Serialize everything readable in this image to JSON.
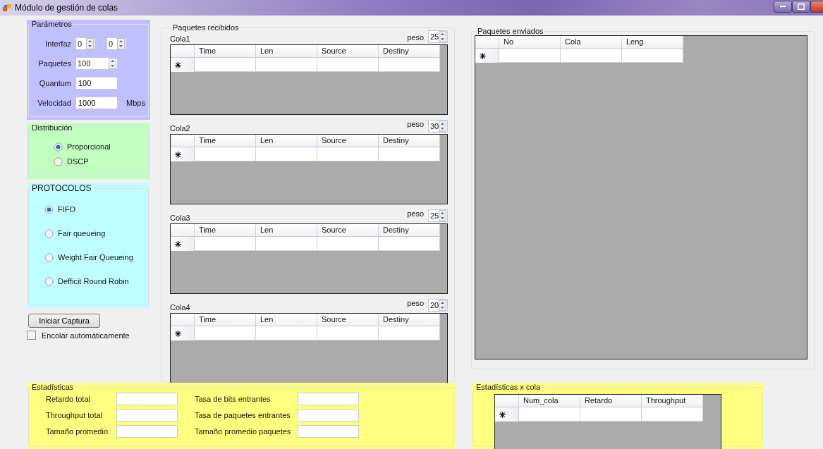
{
  "window": {
    "title": "Módulo de gestión de colas"
  },
  "parametros": {
    "title": "Parámetros",
    "interfaz": {
      "label": "Interfaz",
      "values": [
        "0",
        "0"
      ]
    },
    "paquetes": {
      "label": "Paquetes",
      "value": "100"
    },
    "quantum": {
      "label": "Quantum",
      "value": "100"
    },
    "velocidad": {
      "label": "Velocidad",
      "value": "1000",
      "unit": "Mbps"
    }
  },
  "distribucion": {
    "title": "Distribución",
    "options": [
      {
        "label": "Proporcional",
        "selected": true
      },
      {
        "label": "DSCP",
        "selected": false
      }
    ]
  },
  "protocolos": {
    "title": "PROTOCOLOS",
    "options": [
      {
        "label": "FIFO",
        "selected": true
      },
      {
        "label": "Fair queueing",
        "selected": false
      },
      {
        "label": "Weight Fair Queueing",
        "selected": false
      },
      {
        "label": "Defficit Round Robin",
        "selected": false
      }
    ]
  },
  "start_button": "Iniciar Captura",
  "auto_queue": {
    "label": "Encolar automáticamente",
    "checked": false
  },
  "received": {
    "title": "Paquetes recibidos",
    "queues": [
      {
        "name": "Cola1",
        "weight_label": "peso",
        "weight": "25",
        "columns": [
          "Time",
          "Len",
          "Source",
          "Destiny"
        ]
      },
      {
        "name": "Cola2",
        "weight_label": "peso",
        "weight": "30",
        "columns": [
          "Time",
          "Len",
          "Source",
          "Destiny"
        ]
      },
      {
        "name": "Cola3",
        "weight_label": "peso",
        "weight": "25",
        "columns": [
          "Time",
          "Len",
          "Source",
          "Destiny"
        ]
      },
      {
        "name": "Cola4",
        "weight_label": "peso",
        "weight": "20",
        "columns": [
          "Time",
          "Len",
          "Source",
          "Destiny"
        ]
      }
    ]
  },
  "sent": {
    "title": "Paquetes enviados",
    "columns": [
      "No",
      "Cola",
      "Leng"
    ]
  },
  "stats": {
    "title": "Estadísticas",
    "fields": [
      {
        "label": "Retardo total"
      },
      {
        "label": "Tasa de bits entrantes"
      },
      {
        "label": "Throughput total"
      },
      {
        "label": "Tasa de paquetes entrantes"
      },
      {
        "label": "Tamaño promedio"
      },
      {
        "label": "Tamaño promedio paquetes"
      }
    ]
  },
  "queue_stats": {
    "title": "Estadísticas x cola",
    "columns": [
      "Num_cola",
      "Retardo",
      "Throughput"
    ]
  }
}
